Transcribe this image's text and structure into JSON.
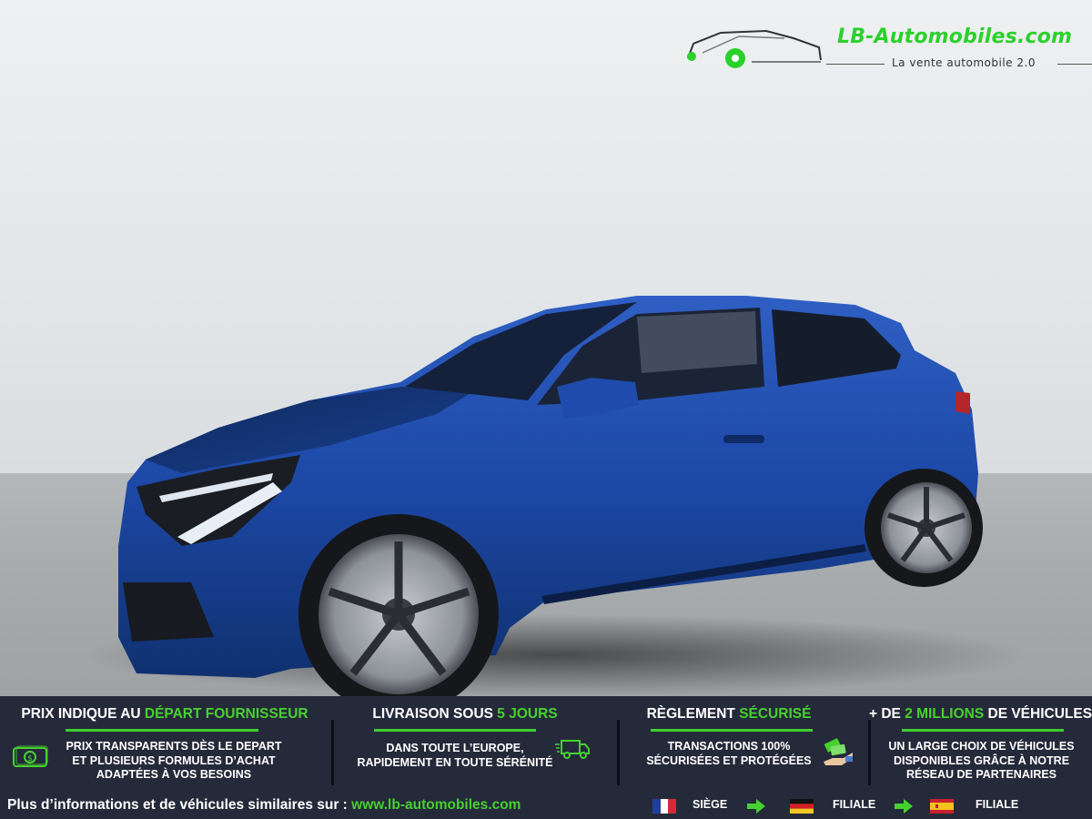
{
  "logo": {
    "name": "LB-Automobiles.com",
    "tagline": "La vente automobile 2.0",
    "brand_color": "#2bd12b"
  },
  "features": [
    {
      "title_prefix": "PRIX INDIQUE AU ",
      "title_highlight": "DÉPART FOURNISSEUR",
      "title_suffix": "",
      "lines": [
        "PRIX TRANSPARENTS DÈS LE DEPART",
        "ET PLUSIEURS FORMULES D’ACHAT",
        "ADAPTÉES À VOS BESOINS"
      ],
      "icon": "money-icon"
    },
    {
      "title_prefix": "LIVRAISON SOUS ",
      "title_highlight": "5 JOURS",
      "title_suffix": "",
      "lines": [
        "DANS TOUTE L’EUROPE,",
        "RAPIDEMENT EN TOUTE SÉRÉNITÉ"
      ],
      "icon": "delivery-truck-icon"
    },
    {
      "title_prefix": "RÈGLEMENT ",
      "title_highlight": "SÉCURISÉ",
      "title_suffix": "",
      "lines": [
        "TRANSACTIONS 100%",
        "SÉCURISÉES ET PROTÉGÉES"
      ],
      "icon": "payment-hand-icon"
    },
    {
      "title_prefix": "+ DE ",
      "title_highlight": "2 MILLIONS",
      "title_suffix": " DE VÉHICULES",
      "lines": [
        "UN LARGE CHOIX DE VÉHICULES",
        "DISPONIBLES GRÂCE À NOTRE",
        "RÉSEAU DE PARTENAIRES"
      ],
      "icon": ""
    }
  ],
  "footer": {
    "more_info": "Plus d’informations et de véhicules similaires sur : ",
    "url": "www.lb-automobiles.com",
    "locations": [
      {
        "flag": "france-flag-icon",
        "label": "SIÈGE"
      },
      {
        "flag": "germany-flag-icon",
        "label": "FILIALE"
      },
      {
        "flag": "spain-flag-icon",
        "label": "FILIALE"
      }
    ]
  },
  "colors": {
    "band_background": "#252a3a",
    "accent_green": "#46d12f",
    "car_body": "#1d4aa8"
  }
}
